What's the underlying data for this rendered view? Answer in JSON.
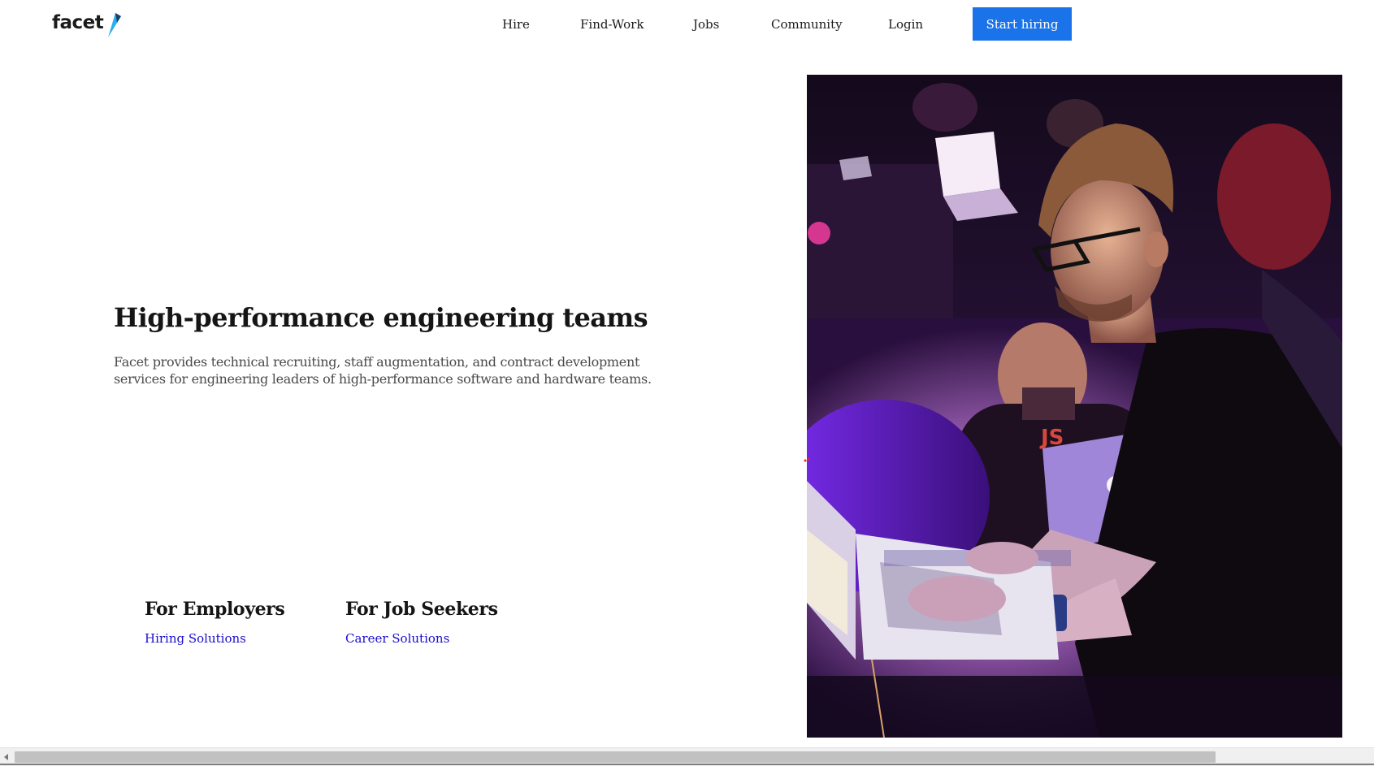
{
  "header": {
    "logo_text": "facet",
    "nav": [
      {
        "label": "Hire"
      },
      {
        "label": "Find-Work"
      },
      {
        "label": "Jobs"
      },
      {
        "label": "Community"
      },
      {
        "label": "Login"
      }
    ],
    "cta_label": "Start hiring"
  },
  "hero": {
    "title": "High-performance engineering teams",
    "description": "Facet provides technical recruiting, staff augmentation, and contract development services for engineering leaders of high-performance software and hardware teams.",
    "image": "photo of developers working on laptops at a hackathon under purple lighting"
  },
  "audiences": [
    {
      "heading": "For Employers",
      "link": "Hiring Solutions"
    },
    {
      "heading": "For Job Seekers",
      "link": "Career Solutions"
    }
  ],
  "colors": {
    "accent": "#1a73e8",
    "link": "#1a0dcc",
    "text": "#151515",
    "muted_text": "#4a4a4a",
    "logo_mark": "#29aef0"
  },
  "icons": {
    "logo_mark": "slash-flag-icon",
    "scroll_left": "scroll-left-arrow-icon"
  }
}
